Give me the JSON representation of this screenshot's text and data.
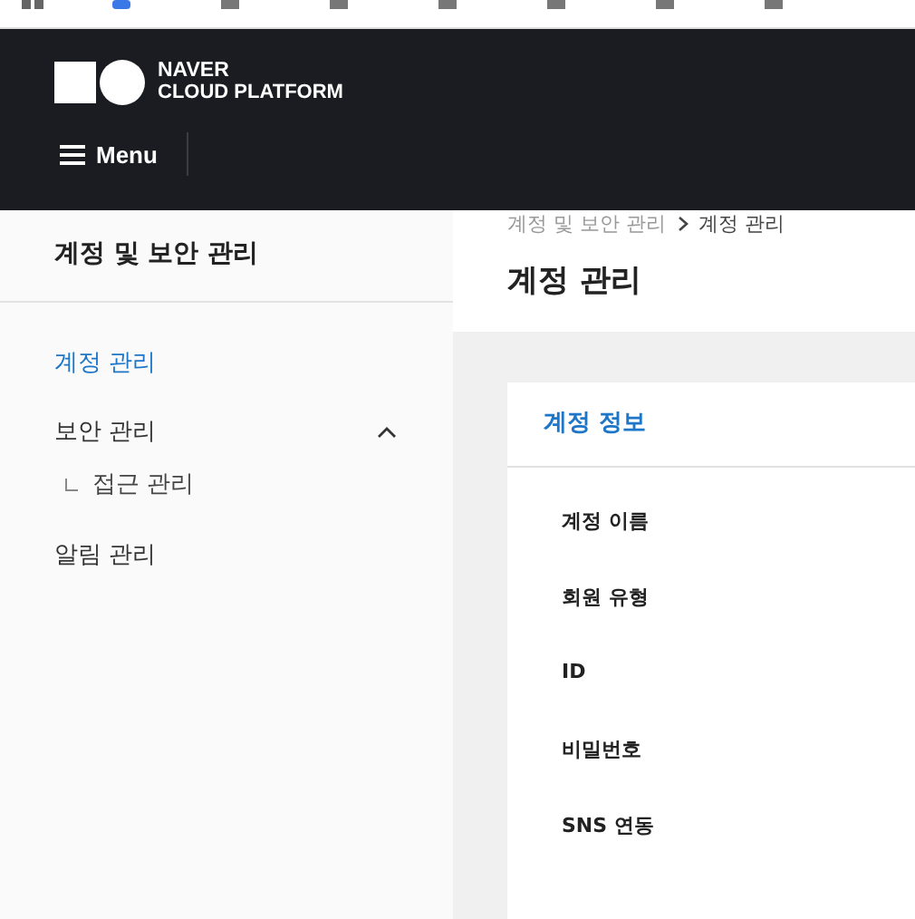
{
  "header": {
    "logo_line_1": "NAVER",
    "logo_line_2": "CLOUD PLATFORM",
    "menu_label": "Menu"
  },
  "sidebar": {
    "title": "계정 및 보안 관리",
    "items": [
      {
        "label": "계정 관리",
        "selected": true
      },
      {
        "label": "보안 관리",
        "selected": false,
        "expanded": true,
        "children": [
          {
            "label": "접근 관리",
            "selected": false
          }
        ]
      },
      {
        "label": "알림 관리",
        "selected": false
      }
    ]
  },
  "breadcrumb": [
    "계정 및 보안 관리",
    "계정 관리"
  ],
  "page_title": "계정 관리",
  "card": {
    "title": "계정 정보",
    "fields": [
      "계정 이름",
      "회원 유형",
      "ID",
      "비밀번호",
      "SNS 연동"
    ]
  }
}
